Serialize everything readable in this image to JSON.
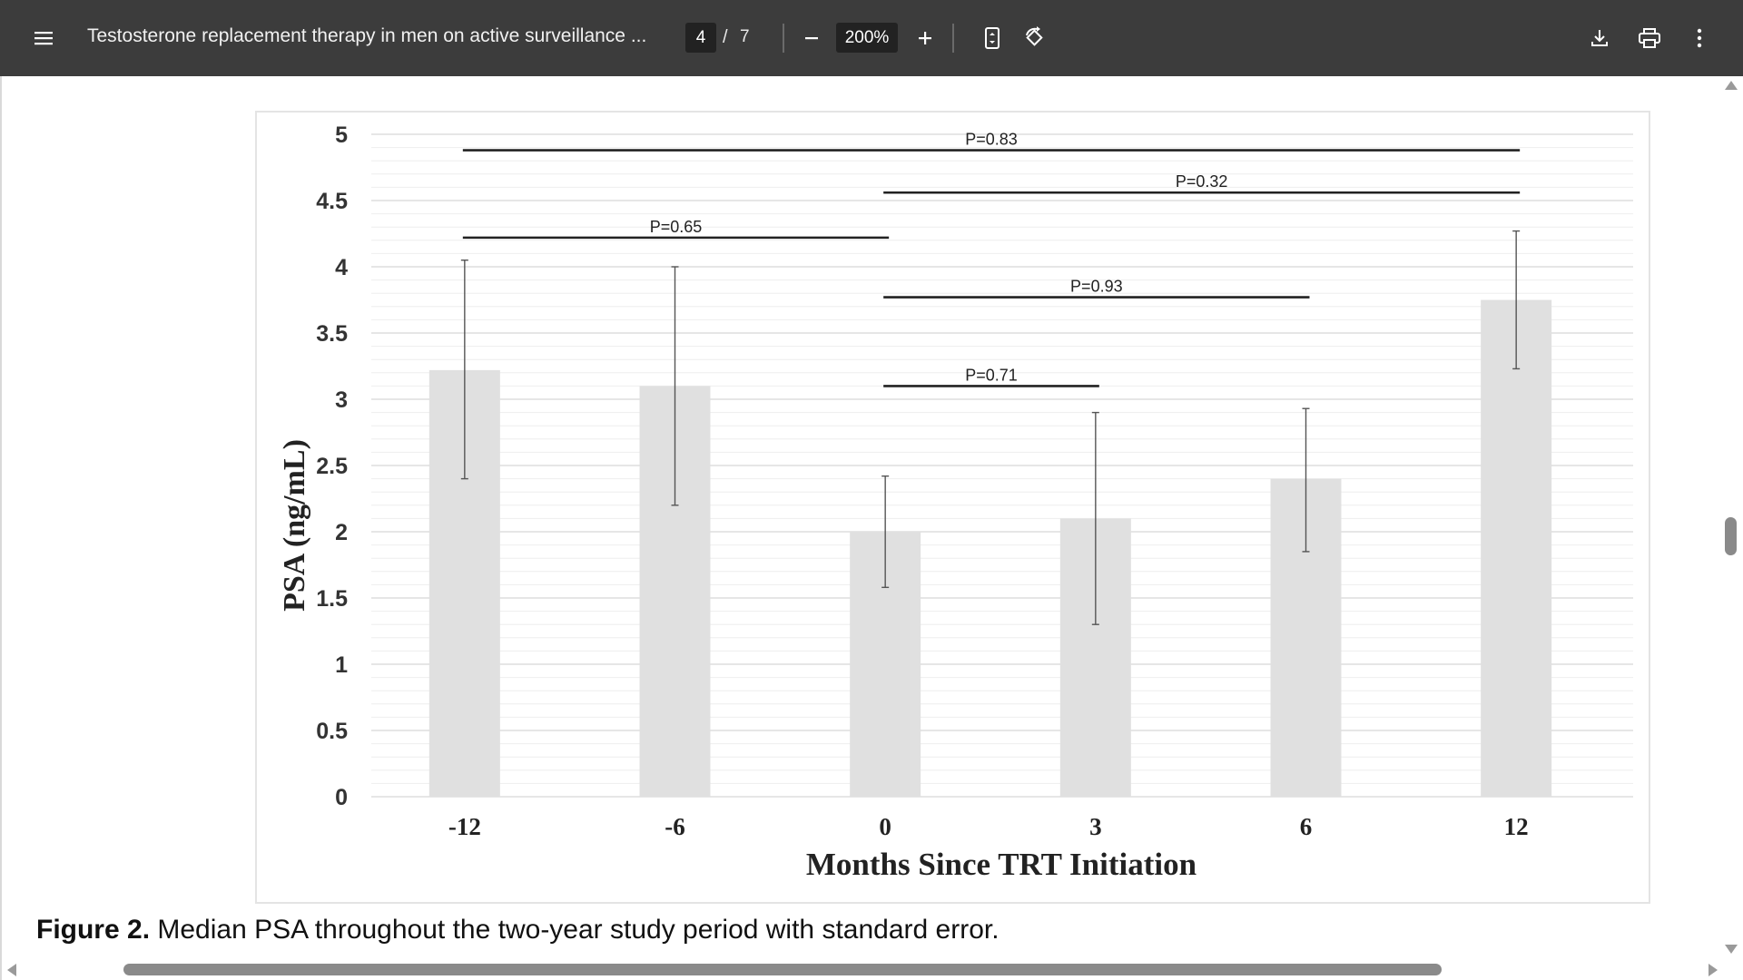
{
  "toolbar": {
    "title": "Testosterone replacement therapy in men on active surveillance ...",
    "current_page": "4",
    "page_separator": "/",
    "total_pages": "7",
    "zoom": "200%",
    "icons": [
      "menu-icon",
      "zoom-out-icon",
      "zoom-in-icon",
      "fit-page-icon",
      "rotate-icon",
      "download-icon",
      "print-icon",
      "more-vert-icon"
    ]
  },
  "caption": {
    "label": "Figure 2.",
    "text": " Median PSA throughout the two-year study period with standard error."
  },
  "colors": {
    "toolbar_bg": "#3c3c3c",
    "bar_fill": "#e0e0e0",
    "text": "#111111"
  },
  "chart_data": {
    "type": "bar",
    "categories": [
      "-12",
      "-6",
      "0",
      "3",
      "6",
      "12"
    ],
    "values": [
      3.22,
      3.1,
      2.0,
      2.1,
      2.4,
      3.75
    ],
    "error_low": [
      2.4,
      2.2,
      1.58,
      1.3,
      1.85,
      3.23
    ],
    "error_high": [
      4.05,
      4.0,
      2.42,
      2.9,
      2.93,
      4.27
    ],
    "xlabel": "Months Since TRT Initiation",
    "ylabel": "PSA (ng/mL)",
    "ylim": [
      0,
      5
    ],
    "yticks": [
      "0",
      "0.5",
      "1",
      "1.5",
      "2",
      "2.5",
      "3",
      "3.5",
      "4",
      "4.5",
      "5"
    ],
    "grid": true,
    "annotations": [
      {
        "text": "P=0.83",
        "from": "-12",
        "to": "12",
        "y": 4.88
      },
      {
        "text": "P=0.32",
        "from": "0",
        "to": "12",
        "y": 4.56
      },
      {
        "text": "P=0.65",
        "from": "-12",
        "to": "0",
        "y": 4.22
      },
      {
        "text": "P=0.93",
        "from": "0",
        "to": "6",
        "y": 3.77
      },
      {
        "text": "P=0.71",
        "from": "0",
        "to": "3",
        "y": 3.1
      }
    ]
  }
}
